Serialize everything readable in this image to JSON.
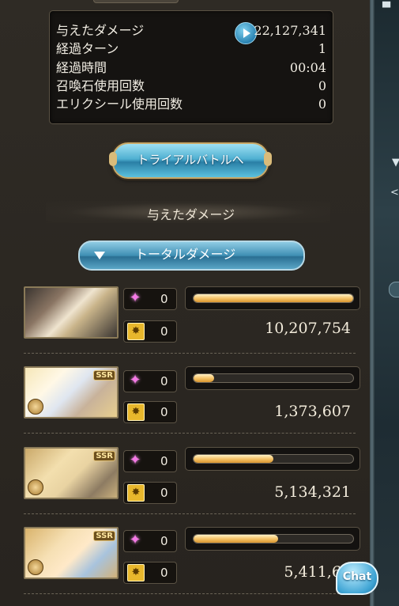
{
  "stats": {
    "rows": [
      {
        "label": "与えたダメージ",
        "value": "22,127,341"
      },
      {
        "label": "経過ターン",
        "value": "1"
      },
      {
        "label": "経過時間",
        "value": "00:04"
      },
      {
        "label": "召喚石使用回数",
        "value": "0"
      },
      {
        "label": "エリクシール使用回数",
        "value": "0"
      }
    ]
  },
  "trial_button_label": "トライアルバトルへ",
  "section_title": "与えたダメージ",
  "dropdown": {
    "selected": "トータルダメージ"
  },
  "characters": [
    {
      "charge_count": "0",
      "ougi_count": "0",
      "damage": "10,207,754",
      "progress": 1.0,
      "rarity": ""
    },
    {
      "charge_count": "0",
      "ougi_count": "0",
      "damage": "1,373,607",
      "progress": 0.13,
      "rarity": "SSR"
    },
    {
      "charge_count": "0",
      "ougi_count": "0",
      "damage": "5,134,321",
      "progress": 0.5,
      "rarity": "SSR"
    },
    {
      "charge_count": "0",
      "ougi_count": "0",
      "damage": "5,411,65",
      "progress": 0.53,
      "rarity": "SSR"
    }
  ],
  "chat_label": "Chat",
  "colors": {
    "gauge_fill": "#f6c56b",
    "panel_bg": "#2a2824",
    "accent_blue": "#3f8fb4"
  },
  "icons": {
    "play": "play-icon",
    "charge": "star-icon",
    "ougi": "burst-icon"
  }
}
